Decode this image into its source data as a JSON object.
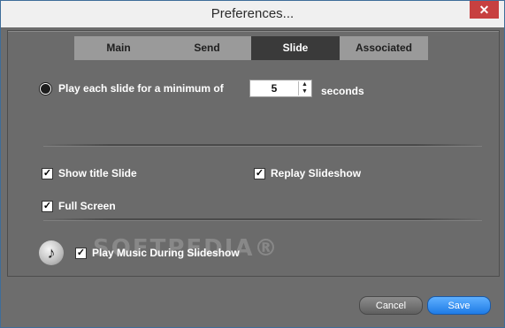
{
  "window": {
    "title": "Preferences...",
    "close_glyph": "✕"
  },
  "tabs": [
    {
      "label": "Main",
      "active": false
    },
    {
      "label": "Send",
      "active": false
    },
    {
      "label": "Slide",
      "active": true
    },
    {
      "label": "Associated",
      "active": false
    }
  ],
  "slide": {
    "min_label": "Play each slide for a minimum of",
    "min_value": "5",
    "seconds_label": "seconds",
    "show_title": {
      "label": "Show title Slide",
      "checked": true
    },
    "replay": {
      "label": "Replay Slideshow",
      "checked": true
    },
    "full_screen": {
      "label": "Full Screen",
      "checked": true
    },
    "play_music": {
      "label": "Play Music During Slideshow",
      "checked": true
    }
  },
  "watermark": "SOFTPEDIA®",
  "buttons": {
    "cancel": "Cancel",
    "save": "Save"
  },
  "icons": {
    "music": "music-note-icon",
    "close": "close-icon",
    "spin_up": "arrow-up-icon",
    "spin_down": "arrow-down-icon"
  },
  "colors": {
    "accent": "#1e7be6",
    "active_tab": "#3a3a3a",
    "panel_bg": "#6b6b6b"
  }
}
